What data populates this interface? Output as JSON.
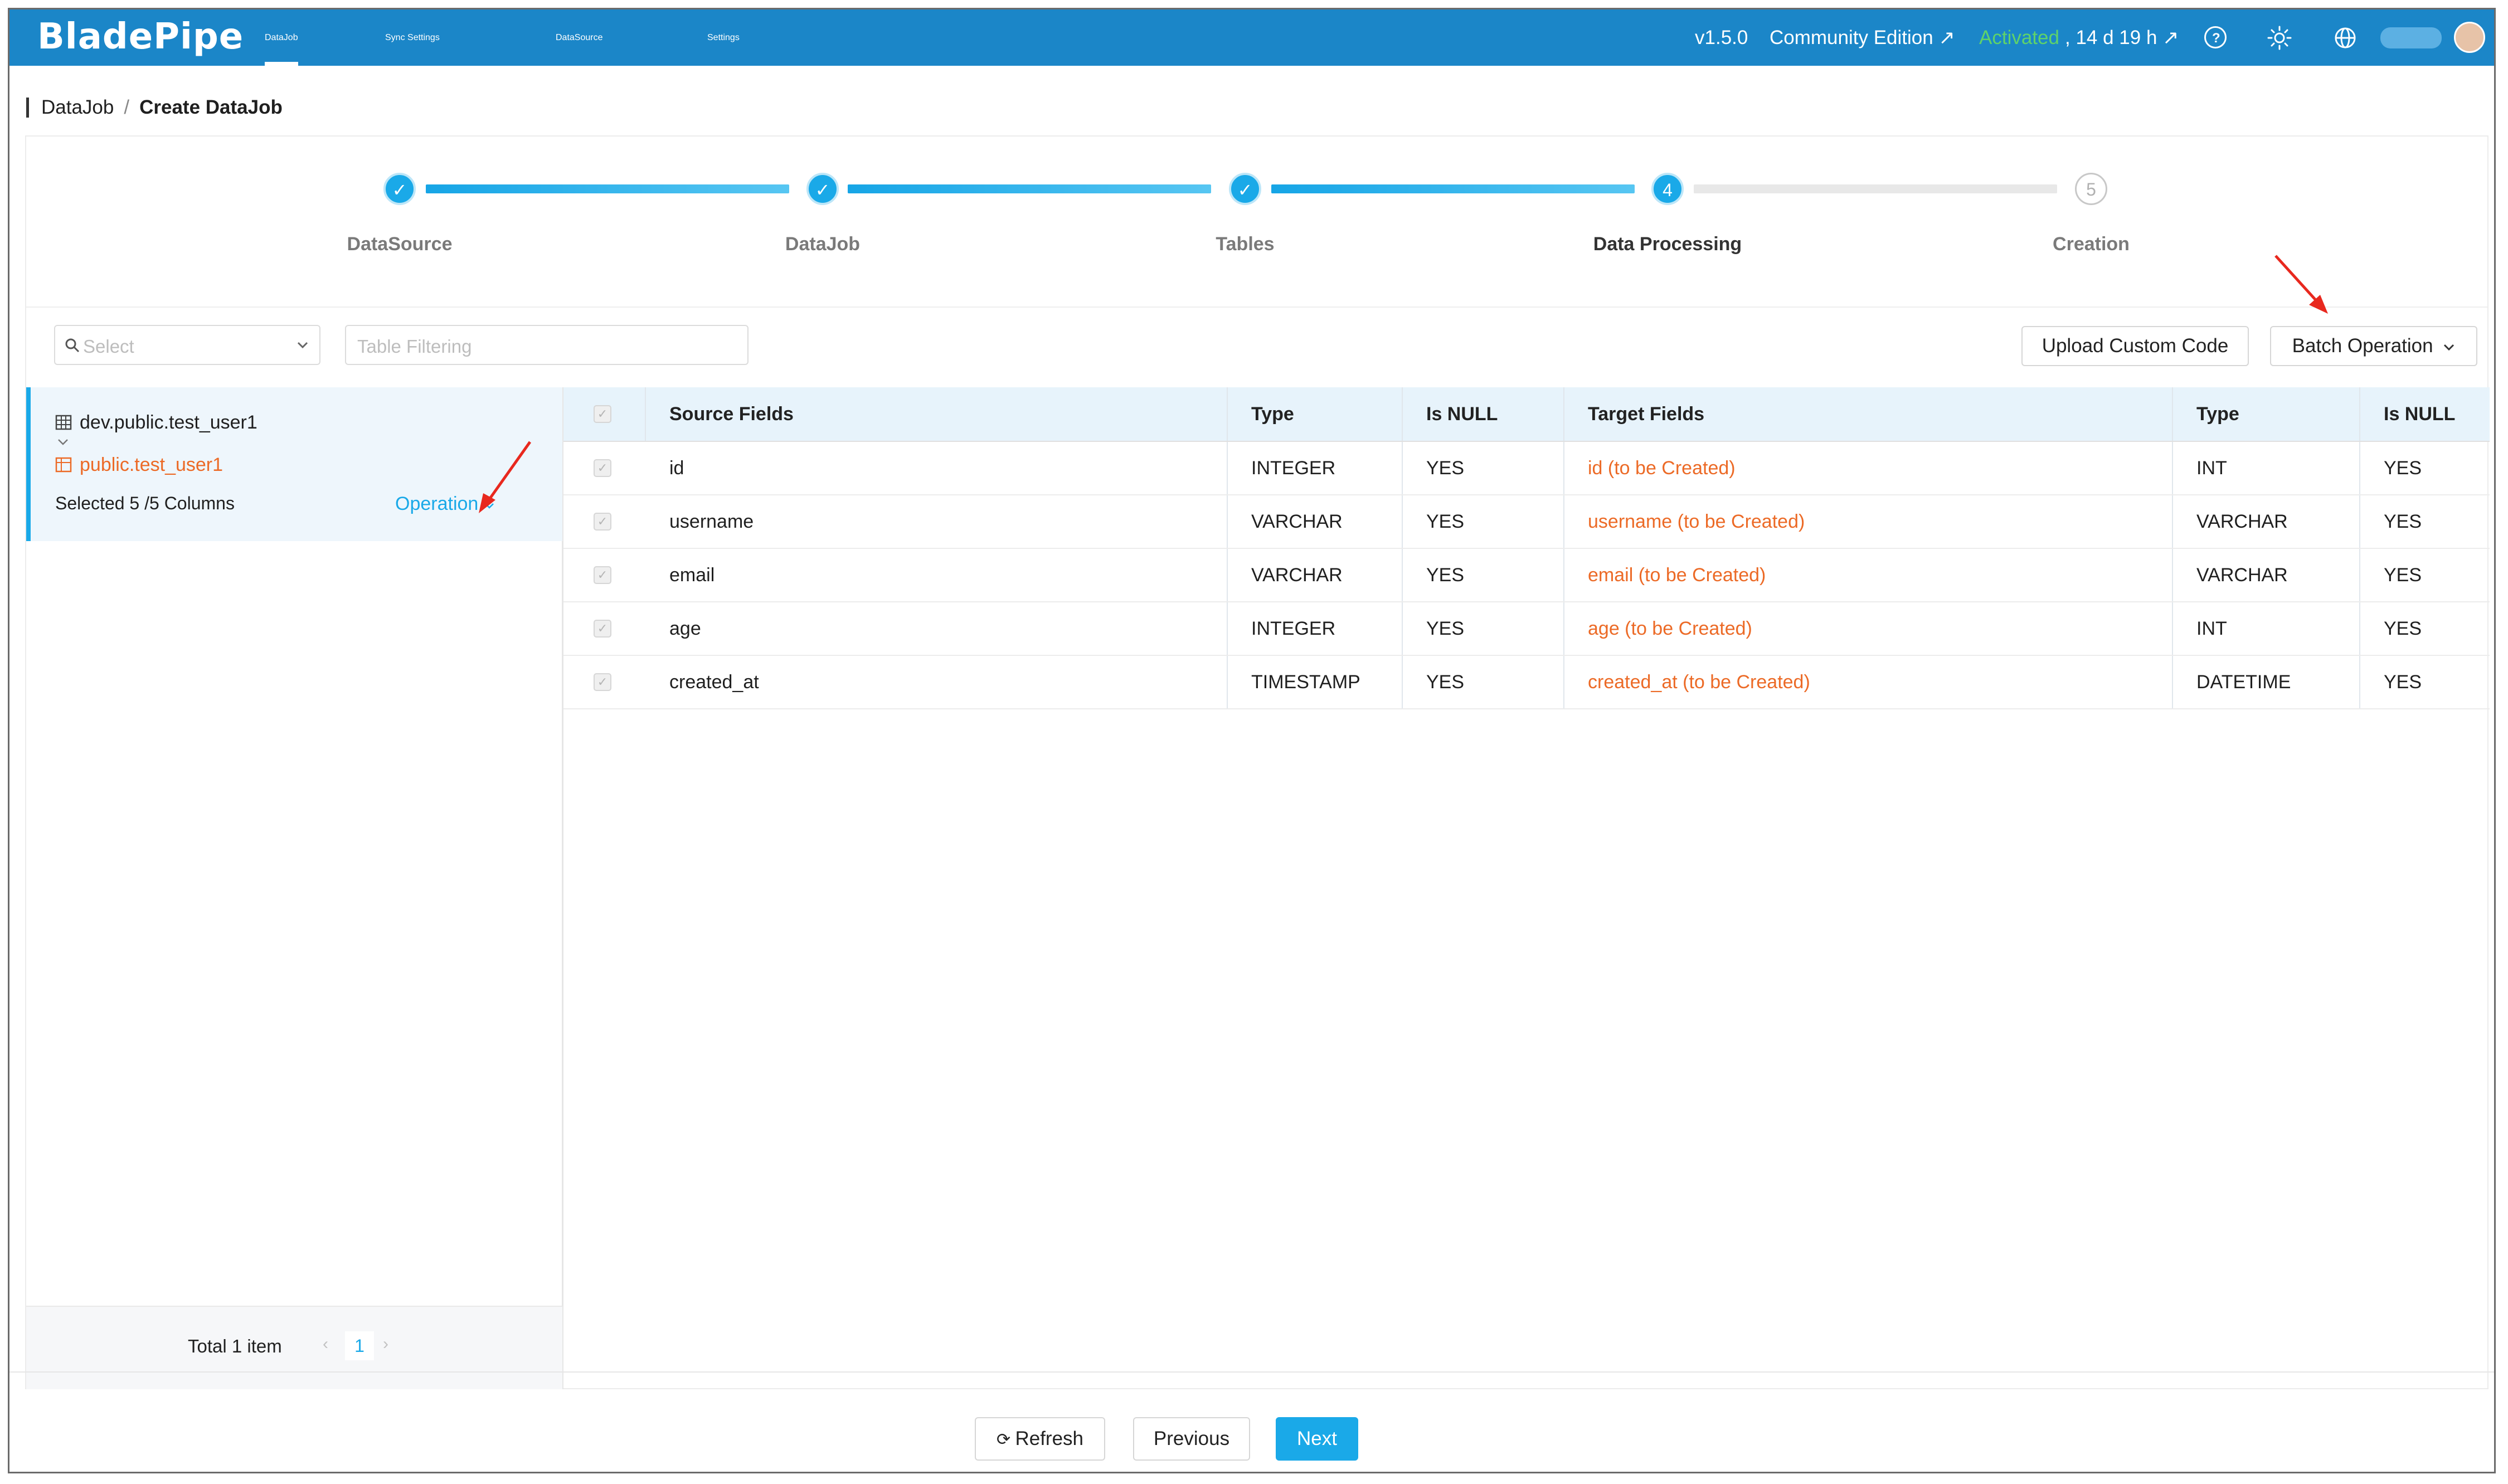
{
  "app": {
    "logo": "BladePipe",
    "nav": [
      "DataJob",
      "Sync Settings",
      "DataSource",
      "Settings"
    ],
    "version": "v1.5.0",
    "edition": "Community Edition ↗",
    "activated": "Activated",
    "license_time": ", 14 d 19 h ↗",
    "icons": [
      "help-icon",
      "theme-sun-icon",
      "language-globe-icon",
      "user-avatar"
    ]
  },
  "breadcrumb": {
    "root": "DataJob",
    "separator": "/",
    "current": "Create DataJob"
  },
  "steps": [
    {
      "label": "DataSource",
      "state": "done"
    },
    {
      "label": "DataJob",
      "state": "done"
    },
    {
      "label": "Tables",
      "state": "done"
    },
    {
      "label": "Data Processing",
      "state": "active",
      "number": "4"
    },
    {
      "label": "Creation",
      "state": "pending",
      "number": "5"
    }
  ],
  "toolbar": {
    "select_placeholder": "Select",
    "filter_placeholder": "Table Filtering",
    "upload_label": "Upload Custom Code",
    "batch_label": "Batch Operation"
  },
  "table_list": {
    "source_table": "dev.public.test_user1",
    "target_table": "public.test_user1",
    "selected_text": "Selected 5 /5 Columns",
    "operation_label": "Operation",
    "total_text": "Total 1 item",
    "page": "1"
  },
  "columns": {
    "source_fields": "Source Fields",
    "type": "Type",
    "is_null": "Is NULL",
    "target_fields": "Target Fields",
    "target_type": "Type",
    "target_is_null": "Is NULL"
  },
  "rows": [
    {
      "source": "id",
      "type": "INTEGER",
      "nullable": "YES",
      "target": "id (to be Created)",
      "target_type": "INT",
      "target_nullable": "YES"
    },
    {
      "source": "username",
      "type": "VARCHAR",
      "nullable": "YES",
      "target": "username (to be Created)",
      "target_type": "VARCHAR",
      "target_nullable": "YES"
    },
    {
      "source": "email",
      "type": "VARCHAR",
      "nullable": "YES",
      "target": "email (to be Created)",
      "target_type": "VARCHAR",
      "target_nullable": "YES"
    },
    {
      "source": "age",
      "type": "INTEGER",
      "nullable": "YES",
      "target": "age (to be Created)",
      "target_type": "INT",
      "target_nullable": "YES"
    },
    {
      "source": "created_at",
      "type": "TIMESTAMP",
      "nullable": "YES",
      "target": "created_at (to be Created)",
      "target_type": "DATETIME",
      "target_nullable": "YES"
    }
  ],
  "footer": {
    "refresh": "Refresh",
    "previous": "Previous",
    "next": "Next"
  },
  "colors": {
    "header_bg": "#1b86c8",
    "accent": "#1aa9e8",
    "target_text": "#ec6a26",
    "activated": "#5fd26a"
  }
}
